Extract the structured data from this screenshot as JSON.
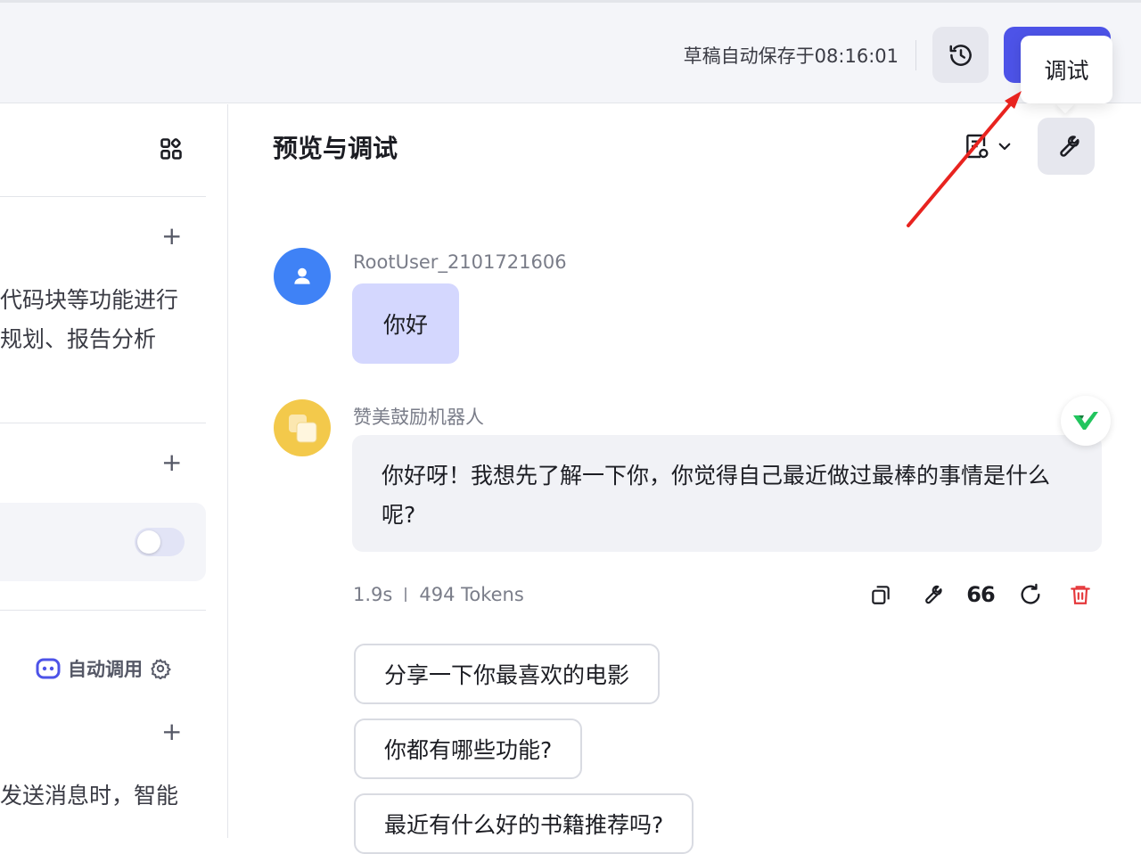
{
  "header": {
    "save_status": "草稿自动保存于08:16:01",
    "history_icon": "history-clock-icon",
    "publish_label": "",
    "tooltip": "调试"
  },
  "left_panel": {
    "grid_icon": "grid-apps-icon",
    "section1_text": [
      "代码块等功能进行",
      "规划、报告分析"
    ],
    "auto_call_label": "自动调用",
    "section3_text": "发送消息时，智能"
  },
  "chat": {
    "title": "预览与调试",
    "user": {
      "name": "RootUser_2101721606",
      "message": "你好"
    },
    "bot": {
      "name": "赞美鼓励机器人",
      "message": "你好呀！我想先了解一下你，你觉得自己最近做过最棒的事情是什么呢?",
      "time": "1.9s",
      "tokens": "494 Tokens"
    },
    "actions": [
      "copy-icon",
      "wrench-icon",
      "quote-icon",
      "refresh-icon",
      "trash-icon"
    ],
    "quote_glyph": "66",
    "suggestions": [
      "分享一下你最喜欢的电影",
      "你都有哪些功能?",
      "最近有什么好的书籍推荐吗?"
    ]
  },
  "colors": {
    "accent": "#4d53e8",
    "user_bubble": "#d4d7fe",
    "bot_bubble": "#f1f2f6",
    "danger": "#e5383b",
    "annotation_arrow": "#e8231f"
  }
}
